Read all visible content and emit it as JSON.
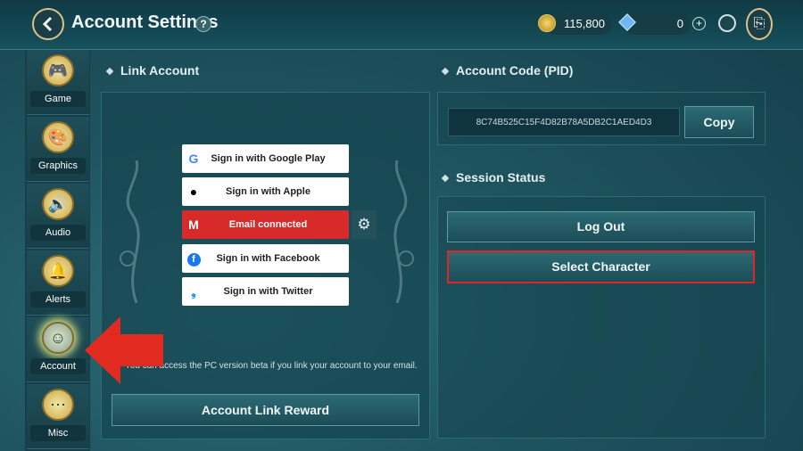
{
  "header": {
    "title": "Account Settings",
    "help": "?",
    "gold": "115,800",
    "gems": "0",
    "plus": "+"
  },
  "sidebar": {
    "items": [
      {
        "label": "Game",
        "icon": "gamepad-icon"
      },
      {
        "label": "Graphics",
        "icon": "palette-icon"
      },
      {
        "label": "Audio",
        "icon": "speaker-icon"
      },
      {
        "label": "Alerts",
        "icon": "bell-icon"
      },
      {
        "label": "Account",
        "icon": "user-icon",
        "active": true
      },
      {
        "label": "Misc",
        "icon": "more-icon"
      }
    ]
  },
  "link_account": {
    "title": "Link Account",
    "buttons": [
      {
        "label": "Sign in with Google Play",
        "icon": "google-icon"
      },
      {
        "label": "Sign in with Apple",
        "icon": "apple-icon"
      },
      {
        "label": "Email connected",
        "icon": "gmail-icon"
      },
      {
        "label": "Sign in with Facebook",
        "icon": "facebook-icon"
      },
      {
        "label": "Sign in with Twitter",
        "icon": "twitter-icon"
      }
    ],
    "info": "You can access the PC version beta if you link your account to your email.",
    "reward_button": "Account Link Reward"
  },
  "account_code": {
    "title": "Account Code (PID)",
    "value": "8C74B525C15F4D82B78A5DB2C1AED4D3",
    "copy_label": "Copy"
  },
  "session": {
    "title": "Session Status",
    "logout_label": "Log Out",
    "select_character_label": "Select Character"
  },
  "colors": {
    "accent_red": "#d82a2a",
    "arrow_red": "#e12a20",
    "panel": "#1a4a54",
    "gold": "#d9c38a"
  }
}
